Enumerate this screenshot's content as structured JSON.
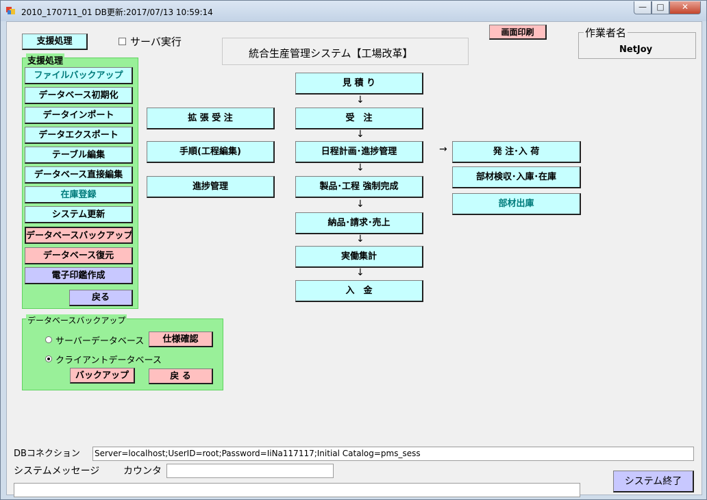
{
  "window": {
    "title": "2010_170711_01 DB更新:2017/07/13 10:59:14",
    "min": "—",
    "max": "□",
    "close": "✕"
  },
  "top": {
    "support_btn": "支援処理",
    "server_exec": "サーバ実行",
    "system_title": "統合生産管理システム【工場改革】",
    "print_btn": "画面印刷",
    "worker_label": "作業者名",
    "worker_name": "NetJoy"
  },
  "support_group": {
    "label": "支援処理",
    "items": [
      "ファイルバックアップ",
      "データベース初期化",
      "データインポート",
      "データエクスポート",
      "テーブル編集",
      "データベース直接編集",
      "在庫登録",
      "システム更新",
      "データベースバックアップ",
      "データベース復元",
      "電子印鑑作成"
    ],
    "back": "戻る"
  },
  "backup_group": {
    "label": "データベースバックアップ",
    "server_db": "サーバーデータベース",
    "client_db": "クライアントデータベース",
    "spec_btn": "仕様確認",
    "backup_btn": "バックアップ",
    "back_btn": "戻 る"
  },
  "flow_left": [
    "拡 張 受 注",
    "手順(工程編集)",
    "進捗管理"
  ],
  "flow_main": [
    "見 積 り",
    "受　注",
    "日程計画･進捗管理",
    "製品･工程 強制完成",
    "納品･請求･売上",
    "実働集計",
    "入　金"
  ],
  "flow_right": [
    "発 注･入 荷",
    "部材検収･入庫･在庫",
    "部材出庫"
  ],
  "arrows": {
    "down": "↓",
    "right": "→"
  },
  "bottom": {
    "db_conn_label": "DBコネクション",
    "db_conn_value": "Server=localhost;UserID=root;Password=IiNa117117;Initial Catalog=pms_sess",
    "sys_msg_label": "システムメッセージ",
    "counter_label": "カウンタ",
    "counter_value": "",
    "sys_msg_value": "",
    "exit_btn": "システム終了"
  }
}
